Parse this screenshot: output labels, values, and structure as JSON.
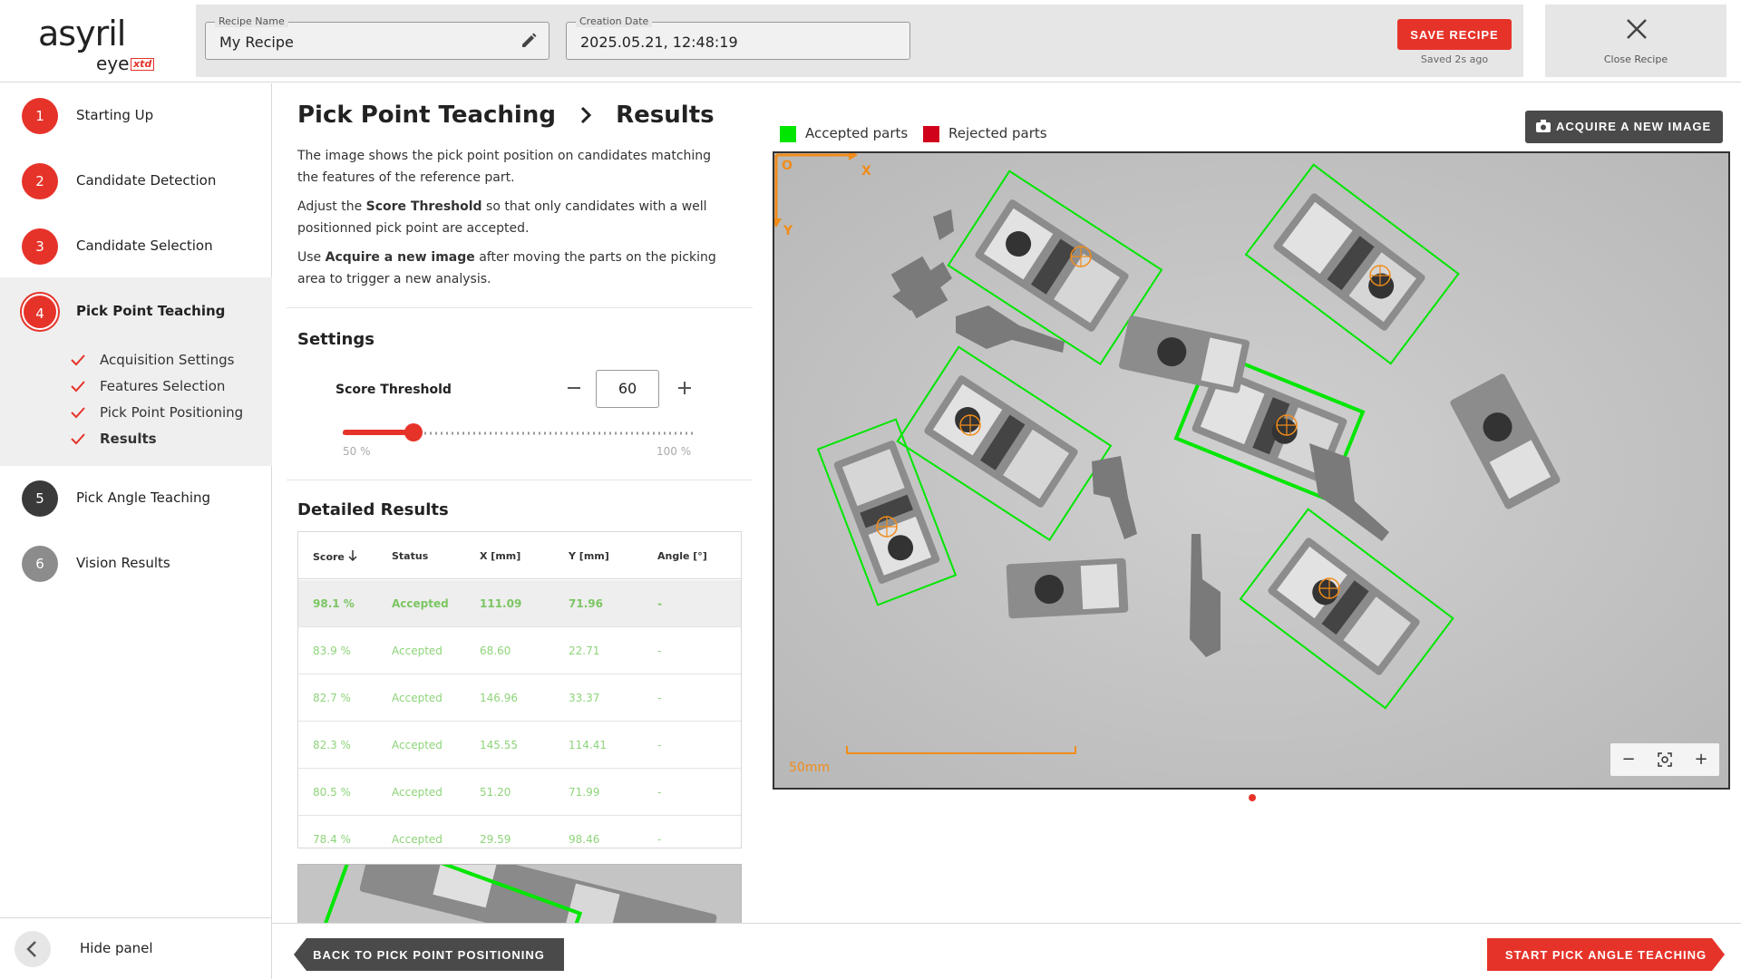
{
  "logo": {
    "main": "asyril",
    "sub": "eye",
    "badge": "xtd"
  },
  "header": {
    "recipe_name_label": "Recipe Name",
    "recipe_name_value": "My Recipe",
    "creation_date_label": "Creation Date",
    "creation_date_value": "2025.05.21, 12:48:19",
    "save_label": "SAVE RECIPE",
    "saved_status": "Saved 2s ago",
    "close_label": "Close Recipe"
  },
  "sidebar": {
    "steps": [
      {
        "num": "1",
        "label": "Starting Up",
        "status": "done"
      },
      {
        "num": "2",
        "label": "Candidate Detection",
        "status": "done"
      },
      {
        "num": "3",
        "label": "Candidate Selection",
        "status": "done"
      },
      {
        "num": "4",
        "label": "Pick Point Teaching",
        "status": "active"
      },
      {
        "num": "5",
        "label": "Pick Angle Teaching",
        "status": "pending"
      },
      {
        "num": "6",
        "label": "Vision Results",
        "status": "disabled"
      }
    ],
    "substeps": [
      {
        "label": "Acquisition Settings"
      },
      {
        "label": "Features Selection"
      },
      {
        "label": "Pick Point Positioning"
      },
      {
        "label": "Results"
      }
    ],
    "hide_label": "Hide panel"
  },
  "main": {
    "title": "Pick Point Teaching",
    "subtitle": "Results",
    "desc1": "The image shows the pick point position on candidates matching the features of the reference part.",
    "desc2_pre": "Adjust the ",
    "desc2_bold": "Score Threshold",
    "desc2_post": " so that only candidates with a well positionned pick point are accepted.",
    "desc3_pre": "Use ",
    "desc3_bold": "Acquire a new image",
    "desc3_post": " after moving the parts on the picking area to trigger a new analysis.",
    "settings_title": "Settings",
    "threshold_label": "Score Threshold",
    "threshold_value": "60",
    "threshold_fraction": 0.2,
    "slider_min": "50 %",
    "slider_max": "100 %",
    "results_title": "Detailed Results",
    "table_headers": [
      "Score",
      "Status",
      "X [mm]",
      "Y [mm]",
      "Angle [°]"
    ],
    "table_rows": [
      [
        "98.1 %",
        "Accepted",
        "111.09",
        "71.96",
        "-"
      ],
      [
        "83.9 %",
        "Accepted",
        "68.60",
        "22.71",
        "-"
      ],
      [
        "82.7 %",
        "Accepted",
        "146.96",
        "33.37",
        "-"
      ],
      [
        "82.3 %",
        "Accepted",
        "145.55",
        "114.41",
        "-"
      ],
      [
        "80.5 %",
        "Accepted",
        "51.20",
        "71.99",
        "-"
      ],
      [
        "78.4 %",
        "Accepted",
        "29.59",
        "98.46",
        "-"
      ]
    ]
  },
  "image_panel": {
    "legend_accepted": "Accepted parts",
    "legend_rejected": "Rejected parts",
    "accepted_color": "#00e600",
    "rejected_color": "#d0021b",
    "acquire_label": "ACQUIRE A NEW IMAGE",
    "axis_origin": "O",
    "axis_x": "X",
    "axis_y": "Y",
    "scale_label": "50mm",
    "zoom_out": "−",
    "zoom_in": "+"
  },
  "footer": {
    "back_label": "BACK TO PICK POINT POSITIONING",
    "next_label": "START PICK ANGLE TEACHING"
  },
  "colors": {
    "accent": "#e6332a",
    "dark": "#3a3a3a",
    "axis": "#f08c1a"
  }
}
